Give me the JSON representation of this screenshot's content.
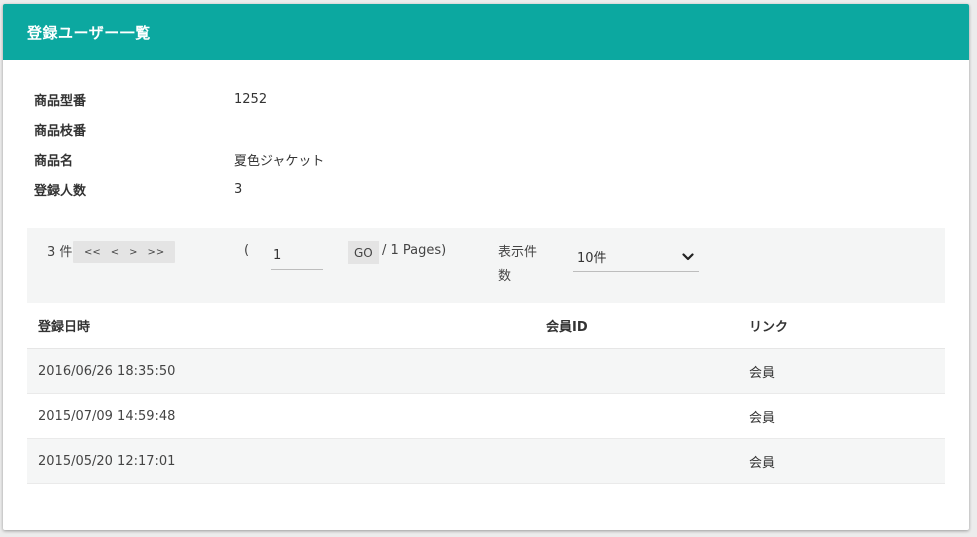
{
  "header": {
    "title": "登録ユーザー一覧"
  },
  "info": [
    {
      "label": "商品型番",
      "value": "1252"
    },
    {
      "label": "商品枝番",
      "value": ""
    },
    {
      "label": "商品名",
      "value": "夏色ジャケット"
    },
    {
      "label": "登録人数",
      "value": "3"
    }
  ],
  "pager": {
    "count": "3 件",
    "first": "<<",
    "prev": "<",
    "next": ">",
    "last": ">>",
    "paren_open": "(",
    "page": "1",
    "go": "GO",
    "total": "/ 1 Pages)",
    "per_page_label": "表示件数",
    "per_page_value": "10件"
  },
  "table": {
    "headers": {
      "date": "登録日時",
      "member_id": "会員ID",
      "link": "リンク"
    },
    "rows": [
      {
        "date": "2016/06/26 18:35:50",
        "member_id": "",
        "link": "会員"
      },
      {
        "date": "2015/07/09 14:59:48",
        "member_id": "",
        "link": "会員"
      },
      {
        "date": "2015/05/20 12:17:01",
        "member_id": "",
        "link": "会員"
      }
    ]
  },
  "colors": {
    "header_bg": "#0ca8a0",
    "header_text": "#ffffff"
  }
}
